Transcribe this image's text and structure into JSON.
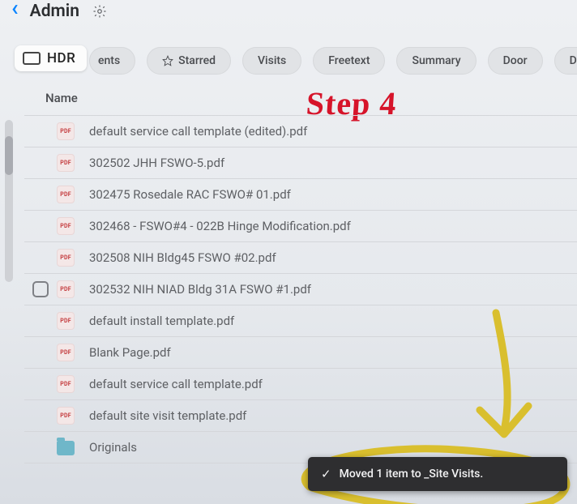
{
  "topbar": {
    "title": "Admin"
  },
  "hdr_badge": "HDR",
  "chips": [
    {
      "label": "ents",
      "icon": null,
      "partial": true
    },
    {
      "label": "Starred",
      "icon": "star"
    },
    {
      "label": "Visits",
      "icon": null
    },
    {
      "label": "Freetext",
      "icon": null
    },
    {
      "label": "Summary",
      "icon": null
    },
    {
      "label": "Door",
      "icon": null
    },
    {
      "label": "Default",
      "icon": null
    }
  ],
  "column_header": "Name",
  "annotation_text": "Step 4",
  "annotation_color": "#d6142a",
  "marker_color": "#d9bf2e",
  "rows": [
    {
      "type": "pdf",
      "name": "default service call template (edited).pdf",
      "checked": false,
      "showCheckbox": false
    },
    {
      "type": "pdf",
      "name": "302502 JHH FSWO-5.pdf",
      "checked": false,
      "showCheckbox": false
    },
    {
      "type": "pdf",
      "name": "302475 Rosedale RAC FSWO# 01.pdf",
      "checked": false,
      "showCheckbox": false
    },
    {
      "type": "pdf",
      "name": "302468 - FSWO#4 - 022B Hinge Modification.pdf",
      "checked": false,
      "showCheckbox": false
    },
    {
      "type": "pdf",
      "name": "302508 NIH Bldg45 FSWO #02.pdf",
      "checked": false,
      "showCheckbox": false
    },
    {
      "type": "pdf",
      "name": "302532 NIH NIAD Bldg 31A FSWO #1.pdf",
      "checked": false,
      "showCheckbox": true
    },
    {
      "type": "pdf",
      "name": "default install template.pdf",
      "checked": false,
      "showCheckbox": false
    },
    {
      "type": "pdf",
      "name": "Blank Page.pdf",
      "checked": false,
      "showCheckbox": false
    },
    {
      "type": "pdf",
      "name": "default service call template.pdf",
      "checked": false,
      "showCheckbox": false
    },
    {
      "type": "pdf",
      "name": "default site visit template.pdf",
      "checked": false,
      "showCheckbox": false
    },
    {
      "type": "folder",
      "name": "Originals",
      "checked": false,
      "showCheckbox": false
    }
  ],
  "toast": {
    "text": "Moved 1 item to _Site Visits."
  }
}
